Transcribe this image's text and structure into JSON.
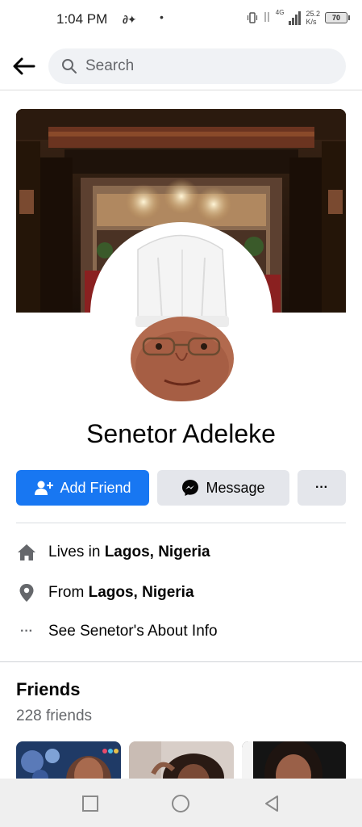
{
  "status_bar": {
    "time": "1:04 PM",
    "carrier_glyph": "∂✦",
    "dot": "•",
    "network_type": "4G",
    "speed_value": "25.2",
    "speed_unit": "K/s",
    "battery": "70"
  },
  "header": {
    "search_placeholder": "Search",
    "back_icon": "arrow-left-icon",
    "search_icon": "magnifier-icon"
  },
  "profile": {
    "name": "Senetor Adeleke",
    "add_friend_label": "Add Friend",
    "message_label": "Message",
    "more_label": "···"
  },
  "about": {
    "lives_prefix": "Lives in ",
    "lives_value": "Lagos, Nigeria",
    "from_prefix": "From ",
    "from_value": "Lagos, Nigeria",
    "about_info_label": "See Senetor's About Info",
    "about_dots": "···"
  },
  "friends": {
    "title": "Friends",
    "count": "228 friends"
  },
  "colors": {
    "accent": "#1877f2",
    "secondary_button": "#e4e6eb",
    "muted_text": "#65676b"
  }
}
